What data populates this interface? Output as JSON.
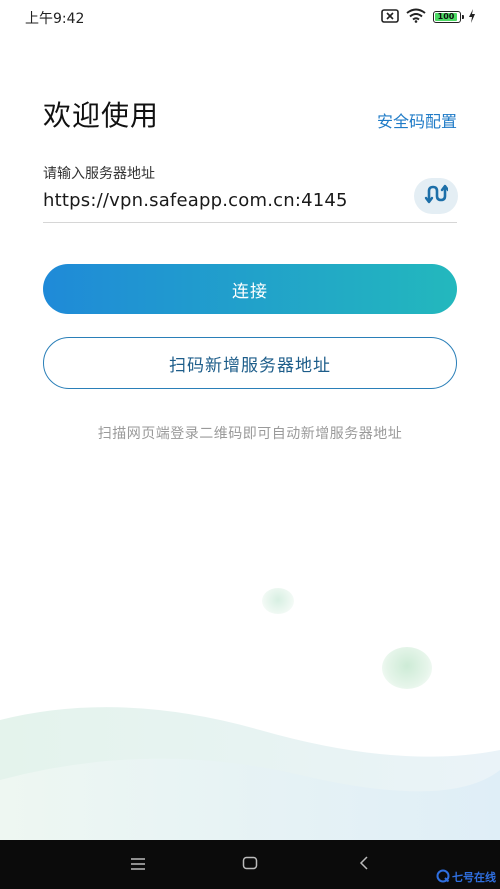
{
  "status_bar": {
    "time": "上午9:42",
    "battery": "100"
  },
  "header": {
    "title": "欢迎使用",
    "security_link": "安全码配置"
  },
  "server": {
    "label": "请输入服务器地址",
    "value": "https://vpn.safeapp.com.cn:4145"
  },
  "actions": {
    "connect": "连接",
    "scan": "扫码新增服务器地址"
  },
  "hint": "扫描网页端登录二维码即可自动新增服务器地址",
  "watermark": {
    "text": "七号在线"
  },
  "colors": {
    "accent": "#1f7bc7",
    "gradient_start": "#1f8ad8",
    "gradient_end": "#23b8bd",
    "scan_border": "#2a7fb8"
  },
  "icons": [
    "close-box-icon",
    "wifi-icon",
    "battery-icon",
    "charging-icon",
    "switch-server-icon",
    "menu-icon",
    "home-icon",
    "back-icon",
    "watermark-logo-icon"
  ]
}
